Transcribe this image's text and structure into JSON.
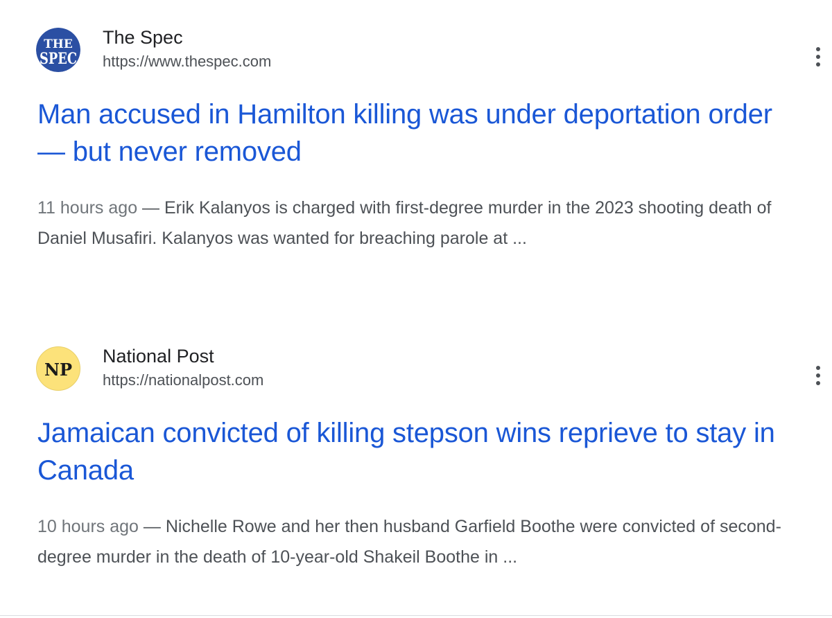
{
  "results": [
    {
      "source_name": "The Spec",
      "source_url": "https://www.thespec.com",
      "favicon_icon": "the-spec-logo-icon",
      "favicon_text": "THE SPEC",
      "favicon_color": "#2b4fa3",
      "headline": "Man accused in Hamilton killing was under deportation order — but never removed",
      "time": "11 hours ago",
      "separator": " — ",
      "snippet": "Erik Kalanyos is charged with first-degree murder in the 2023 shooting death of Daniel Musafiri. Kalanyos was wanted for breaching parole at ..."
    },
    {
      "source_name": "National Post",
      "source_url": "https://nationalpost.com",
      "favicon_icon": "national-post-logo-icon",
      "favicon_text": "NP",
      "favicon_color": "#fce27a",
      "headline": "Jamaican convicted of killing stepson wins reprieve to stay in Canada",
      "time": "10 hours ago",
      "separator": " — ",
      "snippet": "Nichelle Rowe and her then husband Garfield Boothe were convicted of second-degree murder in the death of 10-year-old Shakeil Boothe in ..."
    }
  ],
  "colors": {
    "link": "#1a57d6",
    "text": "#202124",
    "muted": "#4d5156"
  },
  "more_icon": "vertical-ellipsis-icon"
}
